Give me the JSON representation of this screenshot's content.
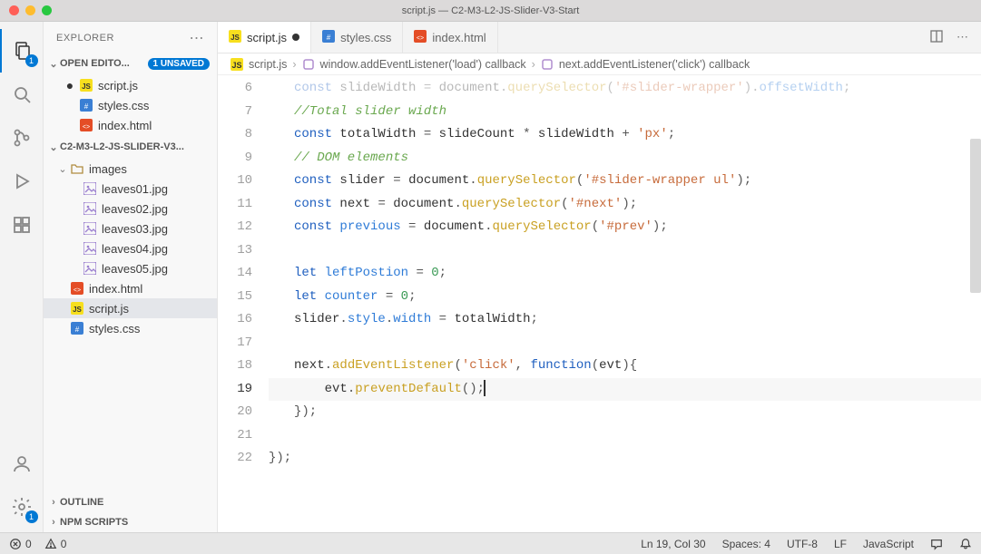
{
  "window": {
    "title": "script.js — C2-M3-L2-JS-Slider-V3-Start"
  },
  "activitybar": {
    "explorer_badge": "1",
    "settings_badge": "1"
  },
  "sidebar": {
    "title": "EXPLORER",
    "open_editors": {
      "label": "OPEN EDITO...",
      "unsaved_badge": "1 UNSAVED",
      "items": [
        {
          "name": "script.js",
          "icon": "js",
          "dirty": true
        },
        {
          "name": "styles.css",
          "icon": "css",
          "dirty": false
        },
        {
          "name": "index.html",
          "icon": "html",
          "dirty": false
        }
      ]
    },
    "project": {
      "label": "C2-M3-L2-JS-SLIDER-V3...",
      "folders": [
        {
          "name": "images",
          "files": [
            {
              "name": "leaves01.jpg",
              "icon": "img"
            },
            {
              "name": "leaves02.jpg",
              "icon": "img"
            },
            {
              "name": "leaves03.jpg",
              "icon": "img"
            },
            {
              "name": "leaves04.jpg",
              "icon": "img"
            },
            {
              "name": "leaves05.jpg",
              "icon": "img"
            }
          ]
        }
      ],
      "files": [
        {
          "name": "index.html",
          "icon": "html"
        },
        {
          "name": "script.js",
          "icon": "js",
          "selected": true
        },
        {
          "name": "styles.css",
          "icon": "css"
        }
      ]
    },
    "outline_label": "OUTLINE",
    "npm_label": "NPM SCRIPTS"
  },
  "tabs": [
    {
      "name": "script.js",
      "icon": "js",
      "active": true,
      "dirty": true
    },
    {
      "name": "styles.css",
      "icon": "css",
      "active": false,
      "dirty": false
    },
    {
      "name": "index.html",
      "icon": "html",
      "active": false,
      "dirty": false
    }
  ],
  "breadcrumb": {
    "file": "script.js",
    "sym1": "window.addEventListener('load') callback",
    "sym2": "next.addEventListener('click') callback"
  },
  "code": {
    "first_line_number": 6,
    "current_line_number": 19,
    "lines": [
      {
        "n": 6,
        "html": "<span class='tok-kw'>const</span> <span class='tok-ident'>slideWidth</span> <span class='tok-punct'>=</span> <span class='tok-ident'>document</span><span class='tok-punct'>.</span><span class='tok-func'>querySelector</span><span class='tok-punct'>(</span><span class='tok-str'>'#slider-wrapper'</span><span class='tok-punct'>).</span><span class='tok-prop'>offsetWidth</span><span class='tok-punct'>;</span>",
        "faded": true
      },
      {
        "n": 7,
        "html": "<span class='tok-comment'>//Total slider width</span>"
      },
      {
        "n": 8,
        "html": "<span class='tok-kw'>const</span> <span class='tok-ident'>totalWidth</span> <span class='tok-punct'>=</span> <span class='tok-ident'>slideCount</span> <span class='tok-punct'>*</span> <span class='tok-ident'>slideWidth</span> <span class='tok-punct'>+</span> <span class='tok-str'>'px'</span><span class='tok-punct'>;</span>"
      },
      {
        "n": 9,
        "html": "<span class='tok-comment'>// DOM elements</span>"
      },
      {
        "n": 10,
        "html": "<span class='tok-kw'>const</span> <span class='tok-ident'>slider</span> <span class='tok-punct'>=</span> <span class='tok-ident'>document</span><span class='tok-punct'>.</span><span class='tok-func'>querySelector</span><span class='tok-punct'>(</span><span class='tok-str'>'#slider-wrapper ul'</span><span class='tok-punct'>);</span>"
      },
      {
        "n": 11,
        "html": "<span class='tok-kw'>const</span> <span class='tok-ident'>next</span> <span class='tok-punct'>=</span> <span class='tok-ident'>document</span><span class='tok-punct'>.</span><span class='tok-func'>querySelector</span><span class='tok-punct'>(</span><span class='tok-str'>'#next'</span><span class='tok-punct'>);</span>"
      },
      {
        "n": 12,
        "html": "<span class='tok-kw'>const</span> <span class='tok-prop'>previous</span> <span class='tok-punct'>=</span> <span class='tok-ident'>document</span><span class='tok-punct'>.</span><span class='tok-func'>querySelector</span><span class='tok-punct'>(</span><span class='tok-str'>'#prev'</span><span class='tok-punct'>);</span>"
      },
      {
        "n": 13,
        "html": ""
      },
      {
        "n": 14,
        "html": "<span class='tok-kw'>let</span> <span class='tok-prop'>leftPostion</span> <span class='tok-punct'>=</span> <span class='tok-num'>0</span><span class='tok-punct'>;</span>"
      },
      {
        "n": 15,
        "html": "<span class='tok-kw'>let</span> <span class='tok-prop'>counter</span> <span class='tok-punct'>=</span> <span class='tok-num'>0</span><span class='tok-punct'>;</span>"
      },
      {
        "n": 16,
        "html": "<span class='tok-ident'>slider</span><span class='tok-punct'>.</span><span class='tok-prop'>style</span><span class='tok-punct'>.</span><span class='tok-prop'>width</span> <span class='tok-punct'>=</span> <span class='tok-ident'>totalWidth</span><span class='tok-punct'>;</span>"
      },
      {
        "n": 17,
        "html": ""
      },
      {
        "n": 18,
        "html": "<span class='tok-ident'>next</span><span class='tok-punct'>.</span><span class='tok-func'>addEventListener</span><span class='tok-punct'>(</span><span class='tok-str'>'click'</span><span class='tok-punct'>,</span> <span class='tok-kw'>function</span><span class='tok-punct'>(</span><span class='tok-ident'>evt</span><span class='tok-punct'>){</span>"
      },
      {
        "n": 19,
        "html": "    <span class='tok-ident'>evt</span><span class='tok-punct'>.</span><span class='tok-func'>preventDefault</span><span class='tok-punct'>();</span><span class='cursor'></span>",
        "current": true
      },
      {
        "n": 20,
        "html": "<span class='tok-punct'>});</span>"
      },
      {
        "n": 21,
        "html": ""
      },
      {
        "n": 22,
        "html": "<span class='tok-punct' style='margin-left:-28px'>});</span>"
      }
    ]
  },
  "status": {
    "errors": "0",
    "warnings": "0",
    "lncol": "Ln 19, Col 30",
    "spaces": "Spaces: 4",
    "encoding": "UTF-8",
    "eol": "LF",
    "language": "JavaScript"
  }
}
